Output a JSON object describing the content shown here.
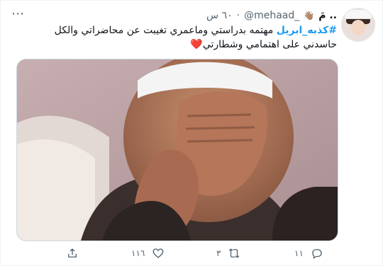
{
  "tweet": {
    "display_name": "مَ ..",
    "hand_emoji": "👋🏽",
    "handle": "@mehaad_",
    "dot": "·",
    "time": "٦٠ س",
    "hashtag": "#كذبه_ابريل",
    "text": "مهتمه بدراستي وماعمري تغيبت عن محاضراتي والكل حاسدني على اهتمامي وشطارتي",
    "heart": "❤️"
  },
  "actions": {
    "reply_count": "١١",
    "retweet_count": "٣",
    "like_count": "١١٦"
  },
  "icons": {
    "more": "more-icon",
    "reply": "reply-icon",
    "retweet": "retweet-icon",
    "like": "heart-icon",
    "share": "share-icon"
  },
  "colors": {
    "accent": "#1d9bf0",
    "muted": "#536471",
    "heart": "#e0245e"
  }
}
